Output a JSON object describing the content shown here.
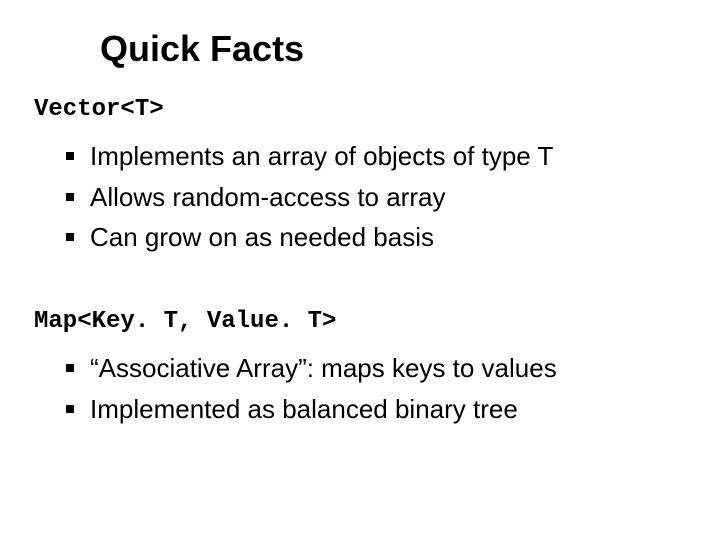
{
  "title": "Quick Facts",
  "sections": [
    {
      "heading": "Vector<T>",
      "items": [
        "Implements an array of objects of type T",
        "Allows random-access to array",
        "Can grow on as needed basis"
      ]
    },
    {
      "heading": "Map<Key. T, Value. T>",
      "items": [
        "“Associative Array”: maps keys to values",
        "Implemented as balanced binary tree"
      ]
    }
  ]
}
